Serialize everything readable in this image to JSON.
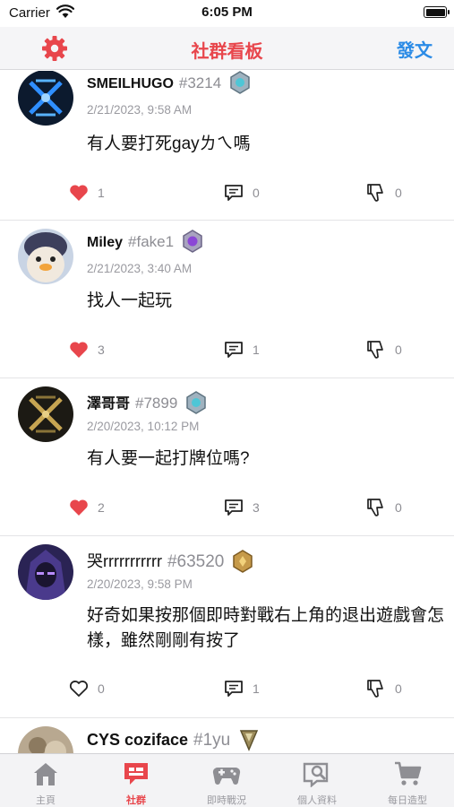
{
  "status_bar": {
    "carrier": "Carrier",
    "time": "6:05 PM"
  },
  "nav": {
    "title": "社群看板",
    "post_button": "發文"
  },
  "posts": [
    {
      "username": "SMEILHUGO",
      "tag": "#3214",
      "timestamp": "2/21/2023, 9:58 AM",
      "content": "有人要打死gayㄌㄟ嗎",
      "likes": "1",
      "liked": true,
      "comments": "0",
      "dislikes": "0"
    },
    {
      "username": "Miley",
      "tag": "#fake1",
      "timestamp": "2/21/2023, 3:40 AM",
      "content": "找人一起玩",
      "likes": "3",
      "liked": true,
      "comments": "1",
      "dislikes": "0"
    },
    {
      "username": "澤哥哥",
      "tag": "#7899",
      "timestamp": "2/20/2023, 10:12 PM",
      "content": "有人要一起打牌位嗎?",
      "likes": "2",
      "liked": true,
      "comments": "3",
      "dislikes": "0"
    },
    {
      "username": "哭rrrrrrrrrrr",
      "tag": "#63520",
      "timestamp": "2/20/2023, 9:58 PM",
      "content": "好奇如果按那個即時對戰右上角的退出遊戲會怎樣，雖然剛剛有按了",
      "likes": "0",
      "liked": false,
      "comments": "1",
      "dislikes": "0"
    },
    {
      "username": "CYS coziface",
      "tag": "#1yu",
      "timestamp": "",
      "content": "",
      "likes": "",
      "liked": false,
      "comments": "",
      "dislikes": ""
    }
  ],
  "tabs": [
    {
      "label": "主頁",
      "icon": "home-icon",
      "active": false
    },
    {
      "label": "社群",
      "icon": "community-icon",
      "active": true
    },
    {
      "label": "即時戰況",
      "icon": "gamepad-icon",
      "active": false
    },
    {
      "label": "個人資料",
      "icon": "profile-icon",
      "active": false
    },
    {
      "label": "每日造型",
      "icon": "cart-icon",
      "active": false
    }
  ],
  "colors": {
    "accent": "#e8464c",
    "link": "#2b8be6",
    "like": "#e8464c",
    "muted": "#9a9aa0"
  }
}
